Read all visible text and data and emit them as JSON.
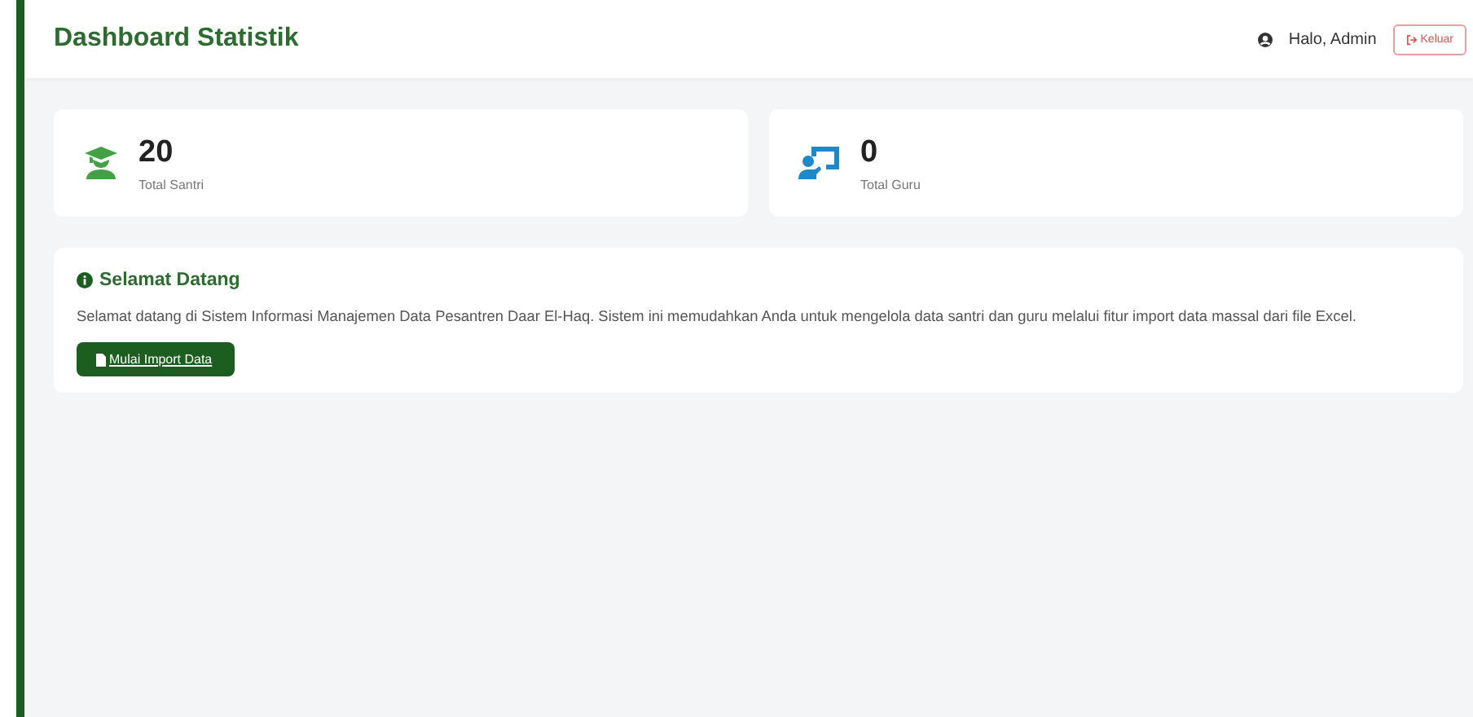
{
  "header": {
    "title": "Dashboard Statistik",
    "user": "Halo, Admin",
    "logout": "Keluar"
  },
  "stats": [
    {
      "kind": "student",
      "value": "20",
      "label": "Total Santri"
    },
    {
      "kind": "teacher",
      "value": "0",
      "label": "Total Guru"
    }
  ],
  "welcome": {
    "title": "Selamat Datang",
    "text": "Selamat datang di Sistem Informasi Manajemen Data Pesantren Daar El-Haq. Sistem ini memudahkan Anda untuk mengelola data santri dan guru melalui fitur import data massal dari file Excel.",
    "button": "Mulai Import Data"
  }
}
